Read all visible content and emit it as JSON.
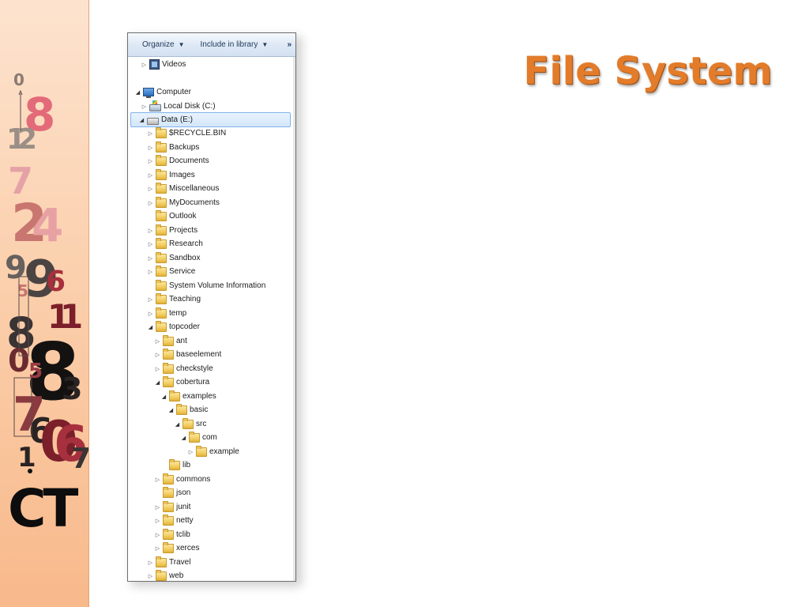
{
  "slide": {
    "title": "File System",
    "title_color": "#e37c2a"
  },
  "toolbar": {
    "organize_label": "Organize",
    "include_label": "Include in library",
    "more_label": "»"
  },
  "tree": [
    {
      "label": "Videos",
      "icon": "videos-icon",
      "arrow": "collapsed"
    },
    {
      "label": "Computer",
      "icon": "computer-icon",
      "arrow": "expanded"
    },
    {
      "label": "Local Disk (C:)",
      "icon": "drive-c-icon",
      "arrow": "collapsed"
    },
    {
      "label": "Data (E:)",
      "icon": "drive-icon",
      "arrow": "expanded",
      "selected": true
    },
    {
      "label": "$RECYCLE.BIN",
      "icon": "folder-icon",
      "arrow": "collapsed"
    },
    {
      "label": "Backups",
      "icon": "folder-icon",
      "arrow": "collapsed"
    },
    {
      "label": "Documents",
      "icon": "folder-icon",
      "arrow": "collapsed"
    },
    {
      "label": "Images",
      "icon": "folder-icon",
      "arrow": "collapsed"
    },
    {
      "label": "Miscellaneous",
      "icon": "folder-icon",
      "arrow": "collapsed"
    },
    {
      "label": "MyDocuments",
      "icon": "folder-icon",
      "arrow": "collapsed"
    },
    {
      "label": "Outlook",
      "icon": "folder-icon",
      "arrow": "none"
    },
    {
      "label": "Projects",
      "icon": "folder-icon",
      "arrow": "collapsed"
    },
    {
      "label": "Research",
      "icon": "folder-icon",
      "arrow": "collapsed"
    },
    {
      "label": "Sandbox",
      "icon": "folder-icon",
      "arrow": "collapsed"
    },
    {
      "label": "Service",
      "icon": "folder-icon",
      "arrow": "collapsed"
    },
    {
      "label": "System Volume Information",
      "icon": "folder-icon",
      "arrow": "none"
    },
    {
      "label": "Teaching",
      "icon": "folder-icon",
      "arrow": "collapsed"
    },
    {
      "label": "temp",
      "icon": "folder-icon",
      "arrow": "collapsed"
    },
    {
      "label": "topcoder",
      "icon": "folder-icon",
      "arrow": "expanded"
    },
    {
      "label": "ant",
      "icon": "folder-icon",
      "arrow": "collapsed"
    },
    {
      "label": "baseelement",
      "icon": "folder-icon",
      "arrow": "collapsed"
    },
    {
      "label": "checkstyle",
      "icon": "folder-icon",
      "arrow": "collapsed"
    },
    {
      "label": "cobertura",
      "icon": "folder-icon",
      "arrow": "expanded"
    },
    {
      "label": "examples",
      "icon": "folder-icon",
      "arrow": "expanded"
    },
    {
      "label": "basic",
      "icon": "folder-icon",
      "arrow": "expanded"
    },
    {
      "label": "src",
      "icon": "folder-icon",
      "arrow": "expanded"
    },
    {
      "label": "com",
      "icon": "folder-icon",
      "arrow": "expanded"
    },
    {
      "label": "example",
      "icon": "folder-icon",
      "arrow": "collapsed"
    },
    {
      "label": "lib",
      "icon": "folder-icon",
      "arrow": "none"
    },
    {
      "label": "commons",
      "icon": "folder-icon",
      "arrow": "collapsed"
    },
    {
      "label": "json",
      "icon": "folder-icon",
      "arrow": "none"
    },
    {
      "label": "junit",
      "icon": "folder-icon",
      "arrow": "collapsed"
    },
    {
      "label": "netty",
      "icon": "folder-icon",
      "arrow": "collapsed"
    },
    {
      "label": "tclib",
      "icon": "folder-icon",
      "arrow": "collapsed"
    },
    {
      "label": "xerces",
      "icon": "folder-icon",
      "arrow": "collapsed"
    },
    {
      "label": "Travel",
      "icon": "folder-icon",
      "arrow": "collapsed"
    },
    {
      "label": "web",
      "icon": "folder-icon",
      "arrow": "collapsed"
    }
  ],
  "decor": {
    "digits": [
      "0",
      "8",
      "1",
      "2",
      "7",
      "2",
      "4",
      "9",
      "9",
      "6",
      "5",
      "1",
      "1",
      "8",
      "8",
      "0",
      "5",
      "3",
      "7",
      "6",
      "0",
      "6",
      "7",
      "1"
    ],
    "logo_text": "CT"
  }
}
